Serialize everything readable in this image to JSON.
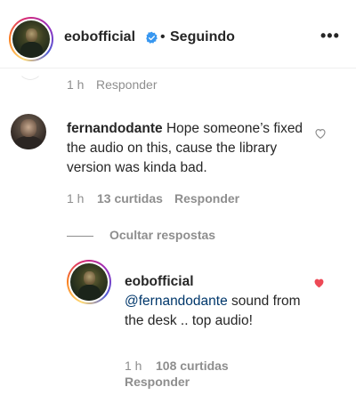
{
  "header": {
    "username": "eobofficial",
    "separator": "•",
    "follow_status": "Seguindo",
    "more": "•••"
  },
  "previous": {
    "time": "1 h",
    "reply": "Responder"
  },
  "comment": {
    "username": "fernandodante",
    "text": "Hope someone’s fixed the audio on this, cause the library version was kinda bad.",
    "time": "1 h",
    "likes": "13 curtidas",
    "reply": "Responder"
  },
  "replies_toggle": "Ocultar respostas",
  "reply": {
    "username": "eobofficial",
    "mention": "@fernandodante",
    "text": " sound from the desk .. top audio!",
    "time": "1 h",
    "likes": "108 curtidas",
    "reply": "Responder",
    "liked": true
  },
  "colors": {
    "verified": "#3897f0",
    "like_active": "#ed4956",
    "mention": "#00376b",
    "secondary_text": "#8e8e8e"
  }
}
